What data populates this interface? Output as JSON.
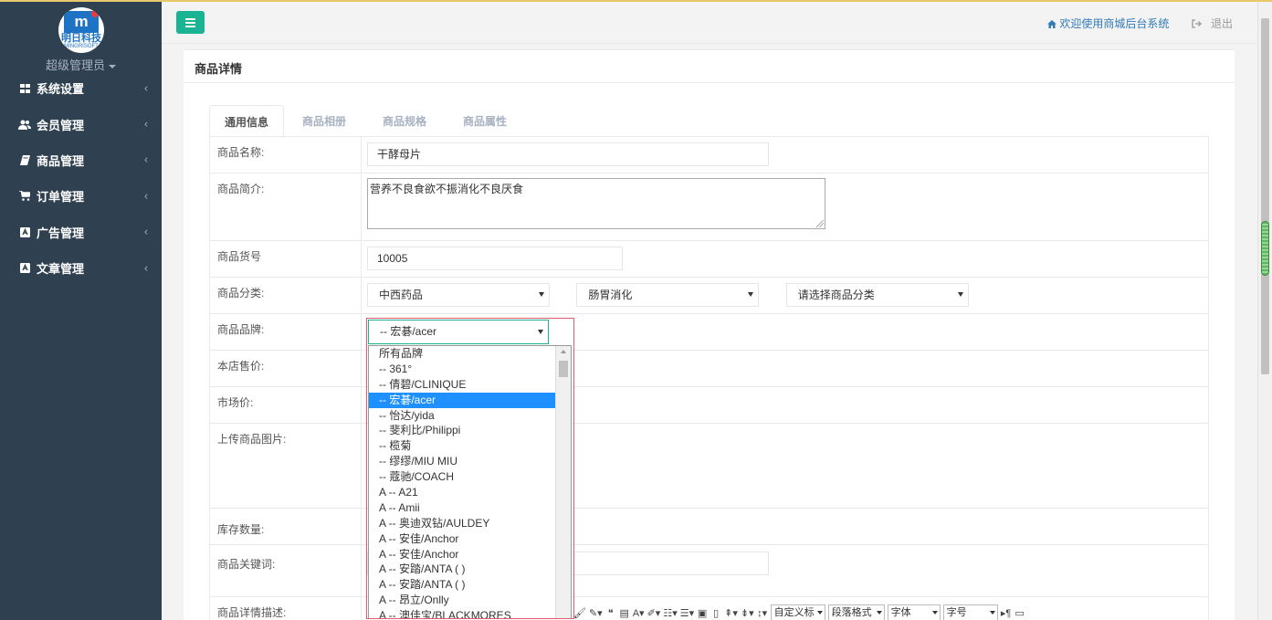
{
  "sidebar": {
    "user_name": "超级管理员",
    "logo_text": "明日科技",
    "logo_sub": "MINGRISOFT",
    "items": [
      {
        "label": "系统设置",
        "icon": "grid-icon"
      },
      {
        "label": "会员管理",
        "icon": "users-icon"
      },
      {
        "label": "商品管理",
        "icon": "book-icon"
      },
      {
        "label": "订单管理",
        "icon": "cart-icon"
      },
      {
        "label": "广告管理",
        "icon": "image-icon"
      },
      {
        "label": "文章管理",
        "icon": "image-icon"
      }
    ]
  },
  "header": {
    "welcome": "欢迎使用商城后台系统",
    "logout": "退出"
  },
  "panel": {
    "title": "商品详情",
    "tabs": [
      "通用信息",
      "商品相册",
      "商品规格",
      "商品属性"
    ]
  },
  "form": {
    "name_label": "商品名称:",
    "name_value": "干酵母片",
    "summary_label": "商品简介:",
    "summary_value": "营养不良食欲不振消化不良厌食",
    "sn_label": "商品货号",
    "sn_value": "10005",
    "category_label": "商品分类:",
    "category1": "中西药品",
    "category2": "肠胃消化",
    "category3": "请选择商品分类",
    "brand_label": "商品品牌:",
    "brand_value": "-- 宏碁/acer",
    "shop_price_label": "本店售价:",
    "market_price_label": "市场价:",
    "image_label": "上传商品图片:",
    "stock_label": "库存数量:",
    "keywords_label": "商品关键词:",
    "detail_label": "商品详情描述:"
  },
  "brand_options": [
    "所有品牌",
    "-- 361°",
    "-- 倩碧/CLINIQUE",
    "-- 宏碁/acer",
    "-- 怡达/yida",
    "-- 斐利比/Philippi",
    "-- 榄菊",
    "-- 缪缪/MIU MIU",
    "-- 蔻驰/COACH",
    "A -- A21",
    "A -- Amii",
    "A -- 奥迪双钻/AULDEY",
    "A -- 安佳/Anchor",
    "A -- 安佳/Anchor",
    "A -- 安踏/ANTA ( )",
    "A -- 安踏/ANTA ( )",
    "A -- 昂立/Onlly",
    "A -- 澳佳宝/BLACKMORES"
  ],
  "brand_selected_index": 3,
  "toolbar": {
    "custom_title": "自定义标",
    "paragraph": "段落格式",
    "font": "字体",
    "font_size": "字号"
  }
}
